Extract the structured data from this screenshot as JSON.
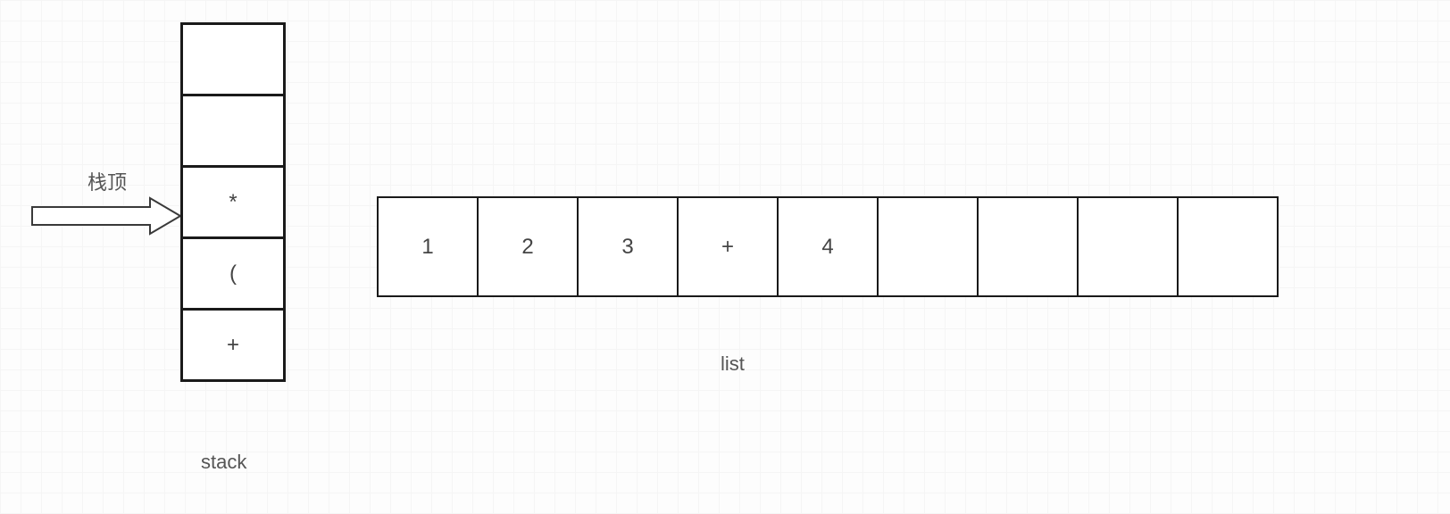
{
  "labels": {
    "stack_top": "栈顶",
    "stack_caption": "stack",
    "list_caption": "list"
  },
  "stack": {
    "cells": [
      "",
      "",
      "*",
      "(",
      "+"
    ]
  },
  "list": {
    "cells": [
      "1",
      "2",
      "3",
      "+",
      "4",
      "",
      "",
      "",
      ""
    ]
  }
}
